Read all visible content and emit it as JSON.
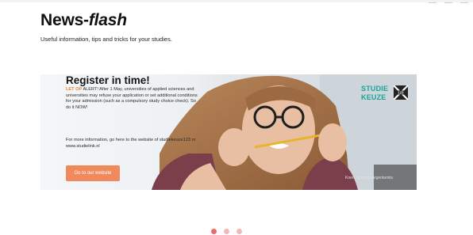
{
  "header": {
    "title_main": "News-",
    "title_accent": "flash",
    "subtitle": "Useful information, tips and tricks for your studies."
  },
  "banner": {
    "title": "Register in time!",
    "alert_prefix": "LET OP",
    "body": "ALERT! After 1 May, universities of applied sciences and universities may refuse your application or set additional conditions for your admission (such as a compulsory study choice check). So do it NOW!",
    "info": "For more information, go here to the website of studiekeuze123 or www.studielink.nl",
    "button_label": "Go to our website",
    "logo_line1": "STUDIE",
    "logo_line2": "KEUZE",
    "logo_badge": "123",
    "photo_credit": "Koen Huisman/argentumilu"
  },
  "carousel": {
    "dot_count": 3,
    "active_index": 0
  },
  "colors": {
    "accent": "#f08a5d",
    "brand": "#1aa39a",
    "dot_active": "#e86b6b",
    "dot_inactive": "#f3b8b8"
  }
}
